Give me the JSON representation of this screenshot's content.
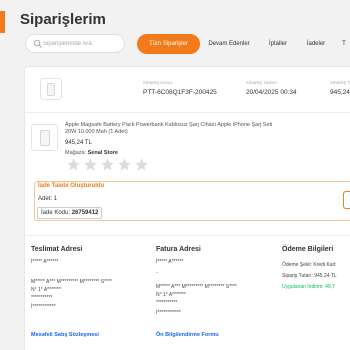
{
  "header": {
    "title": "Siparişlerim"
  },
  "search": {
    "placeholder": "Siparişlerimde Ara"
  },
  "tabs": [
    {
      "label": "Tüm Siparişler",
      "active": true
    },
    {
      "label": "Devam Edenler"
    },
    {
      "label": "İptaller"
    },
    {
      "label": "İadeler"
    },
    {
      "label": "T"
    }
  ],
  "order": {
    "code_label": "SİPARİŞ KODU",
    "code": "PTT-6C08Q1F3F-200425",
    "date_label": "SİPARİŞ TARİHİ",
    "date": "20/04/2025 00:34",
    "total_label": "SİPARİŞ T",
    "total": "945,24"
  },
  "product": {
    "name": "Apple Magsafe Battery Pack Powerbank Kablosuz Şarj Cihazı Apple iPhone Şarj Seti 20W 10.000 Mah (1 Adet)",
    "price": "945,24 TL",
    "seller_label": "Mağaza:",
    "seller": "Senal Store",
    "rating_stars": 5
  },
  "return": {
    "title": "İade Talebi Oluşturuldu",
    "qty": "Adet: 1",
    "code_label": "İade Kodu:",
    "code": "26759412"
  },
  "delivery": {
    "title": "Teslimat Adresi",
    "name": "İ***** A******",
    "address1": "M***** A*** M********* M******** S****",
    "address2": "N° 1* A*******",
    "address3": "***********",
    "phone": "İ************",
    "link": "Mesafeli Satış Sözleşmesi"
  },
  "billing": {
    "title": "Fatura Adresi",
    "name": "İ***** A******",
    "dash": "-",
    "address1": "M***** A*** M********* M******** S****",
    "address2": "N° 1* A*******",
    "address3": "***********",
    "phone": "İ************",
    "link": "Ön Bilgilendirme Formu"
  },
  "payment": {
    "title": "Ödeme Bilgileri",
    "method": "Ödeme Şekli: Kredi Kart",
    "total": "Sipariş Tutarı: 945,24 TL",
    "discount": "Uygulanan İndirim: 49,7"
  },
  "colors": {
    "accent": "#f27a1a",
    "link": "#1b64f2",
    "discount": "#0bc15c"
  }
}
